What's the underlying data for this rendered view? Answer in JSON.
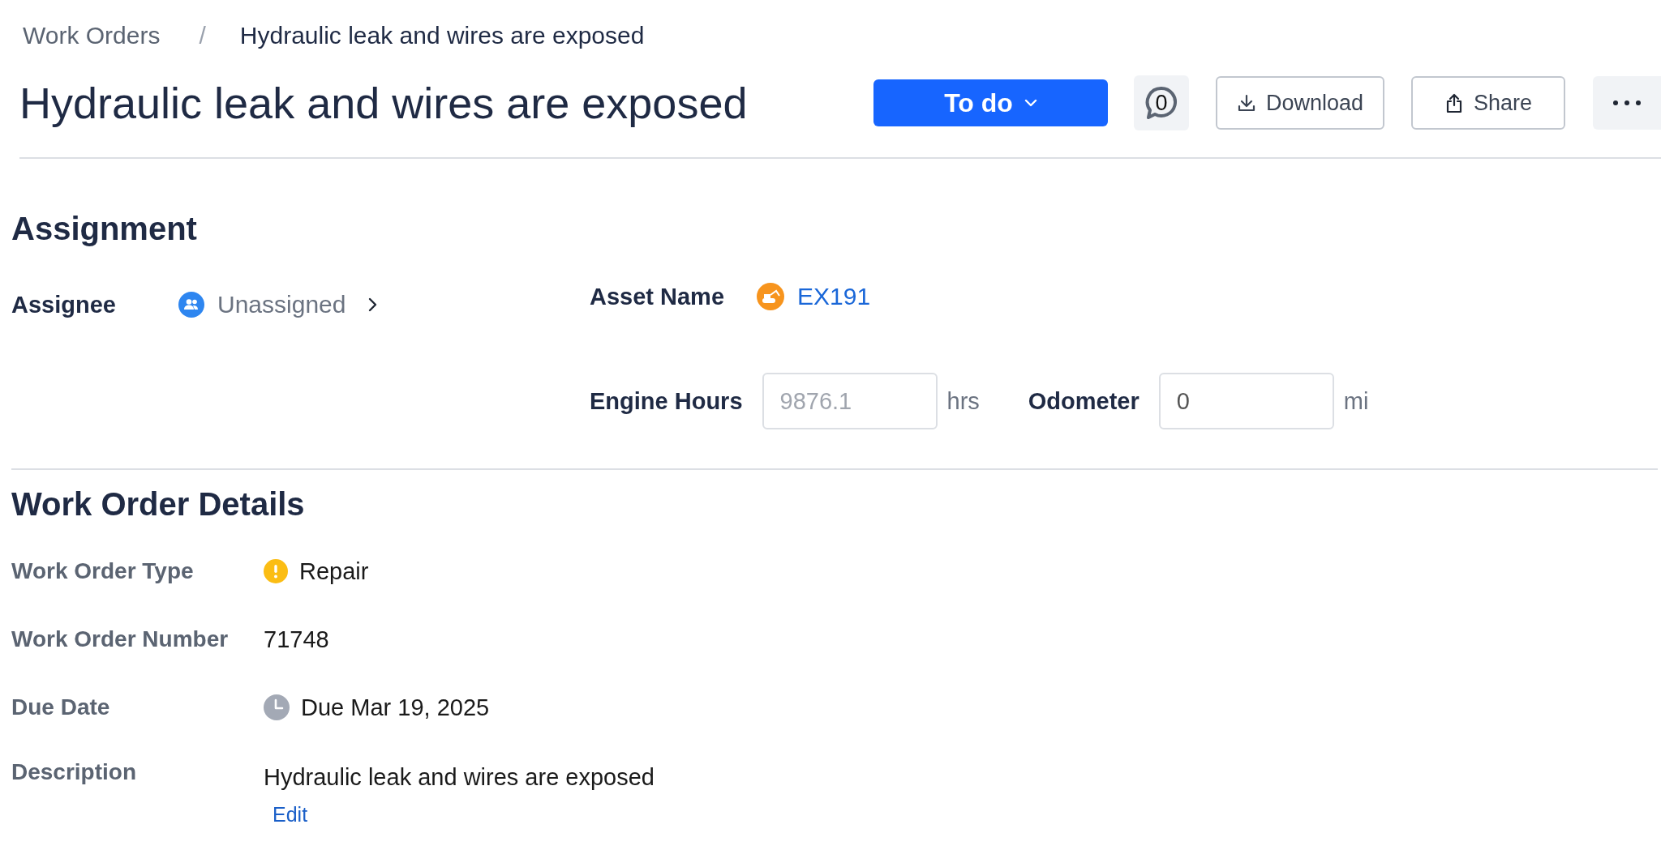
{
  "breadcrumb": {
    "parent": "Work Orders",
    "separator": "/",
    "current": "Hydraulic leak and wires are exposed"
  },
  "header": {
    "title": "Hydraulic leak and wires are exposed",
    "status_button": "To do",
    "comment_count": "0",
    "download_button": "Download",
    "share_button": "Share"
  },
  "assignment": {
    "heading": "Assignment",
    "assignee_label": "Assignee",
    "assignee_value": "Unassigned",
    "asset_label": "Asset Name",
    "asset_value": "EX191",
    "meters": [
      {
        "label": "Engine Hours",
        "placeholder": "9876.1",
        "unit": "hrs"
      },
      {
        "label": "Odometer",
        "value": "0",
        "unit": "mi"
      }
    ]
  },
  "details": {
    "heading": "Work Order Details",
    "rows": [
      {
        "kind": "type",
        "label": "Work Order Type",
        "value": "Repair"
      },
      {
        "kind": "plain",
        "label": "Work Order Number",
        "value": "71748"
      },
      {
        "kind": "date",
        "label": "Due Date",
        "value": "Due Mar 19, 2025"
      },
      {
        "kind": "description",
        "label": "Description",
        "value": "Hydraulic leak and wires are exposed",
        "link": "Edit"
      }
    ]
  }
}
